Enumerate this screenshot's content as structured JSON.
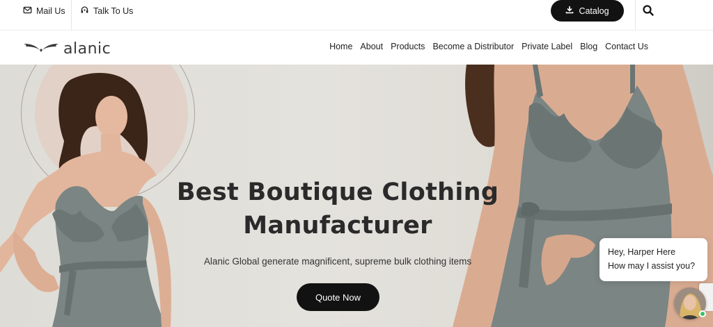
{
  "topbar": {
    "mail_label": "Mail Us",
    "talk_label": "Talk To Us",
    "catalog_label": "Catalog"
  },
  "brand": {
    "name": "alanic"
  },
  "nav": {
    "items": [
      "Home",
      "About",
      "Products",
      "Become a Distributor",
      "Private Label",
      "Blog",
      "Contact Us"
    ]
  },
  "hero": {
    "title_line1": "Best Boutique Clothing",
    "title_line2": "Manufacturer",
    "subtitle": "Alanic Global generate magnificent, supreme bulk clothing items",
    "cta_label": "Quote Now"
  },
  "chat": {
    "line1": "Hey, Harper Here",
    "line2": "How may I assist you?"
  },
  "colors": {
    "button_dark": "#121212",
    "hero_bg": "#e2e0db",
    "dress": "#7b8583",
    "online": "#36c26b"
  },
  "icons": [
    "mail-icon",
    "headset-icon",
    "download-icon",
    "search-icon",
    "wings-logo-icon"
  ]
}
